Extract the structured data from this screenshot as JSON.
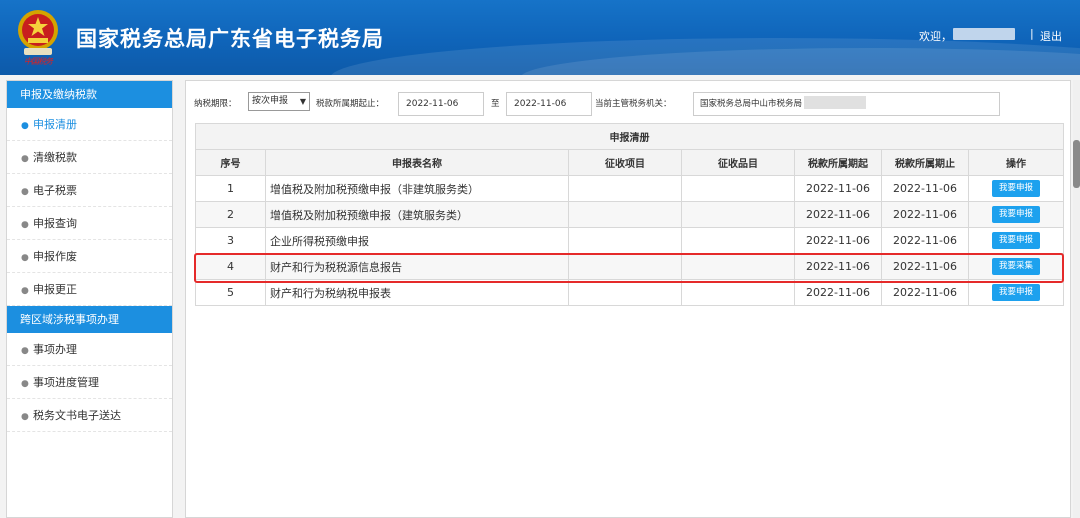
{
  "header": {
    "title": "国家税务总局广东省电子税务局",
    "emblem_caption": "中国税务",
    "welcome": "欢迎，",
    "separator": "|",
    "logout": "退出"
  },
  "sidebar": {
    "groups": [
      {
        "label": "申报及缴纳税款",
        "items": [
          {
            "label": "申报清册",
            "active": true
          },
          {
            "label": "清缴税款"
          },
          {
            "label": "电子税票"
          },
          {
            "label": "申报查询"
          },
          {
            "label": "申报作废"
          },
          {
            "label": "申报更正"
          }
        ]
      },
      {
        "label": "跨区域涉税事项办理",
        "items": [
          {
            "label": "事项办理"
          },
          {
            "label": "事项进度管理"
          },
          {
            "label": "税务文书电子送达"
          }
        ]
      }
    ]
  },
  "filters": {
    "period_label": "纳税期限：",
    "period_value": "按次申报",
    "date_label": "税款所属期起止：",
    "date_from": "2022-11-06",
    "to_label": "至",
    "date_to": "2022-11-06",
    "org_label": "当前主管税务机关：",
    "org_value": "国家税务总局中山市税务局"
  },
  "table": {
    "caption": "申报清册",
    "columns": [
      "序号",
      "申报表名称",
      "征收项目",
      "征收品目",
      "税款所属期起",
      "税款所属期止",
      "操作"
    ],
    "rows": [
      {
        "no": "1",
        "name": "增值税及附加税预缴申报（非建筑服务类）",
        "item": "",
        "sub": "",
        "from": "2022-11-06",
        "to": "2022-11-06",
        "action": "我要申报"
      },
      {
        "no": "2",
        "name": "增值税及附加税预缴申报（建筑服务类）",
        "item": "",
        "sub": "",
        "from": "2022-11-06",
        "to": "2022-11-06",
        "action": "我要申报"
      },
      {
        "no": "3",
        "name": "企业所得税预缴申报",
        "item": "",
        "sub": "",
        "from": "2022-11-06",
        "to": "2022-11-06",
        "action": "我要申报"
      },
      {
        "no": "4",
        "name": "财产和行为税税源信息报告",
        "item": "",
        "sub": "",
        "from": "2022-11-06",
        "to": "2022-11-06",
        "action": "我要采集"
      },
      {
        "no": "5",
        "name": "财产和行为税纳税申报表",
        "item": "",
        "sub": "",
        "from": "2022-11-06",
        "to": "2022-11-06",
        "action": "我要申报"
      }
    ]
  },
  "colors": {
    "header_blue": "#0f64b9",
    "accent_blue": "#1c8fe0",
    "button_blue": "#1da1ee",
    "highlight_red": "#e52a2a"
  }
}
